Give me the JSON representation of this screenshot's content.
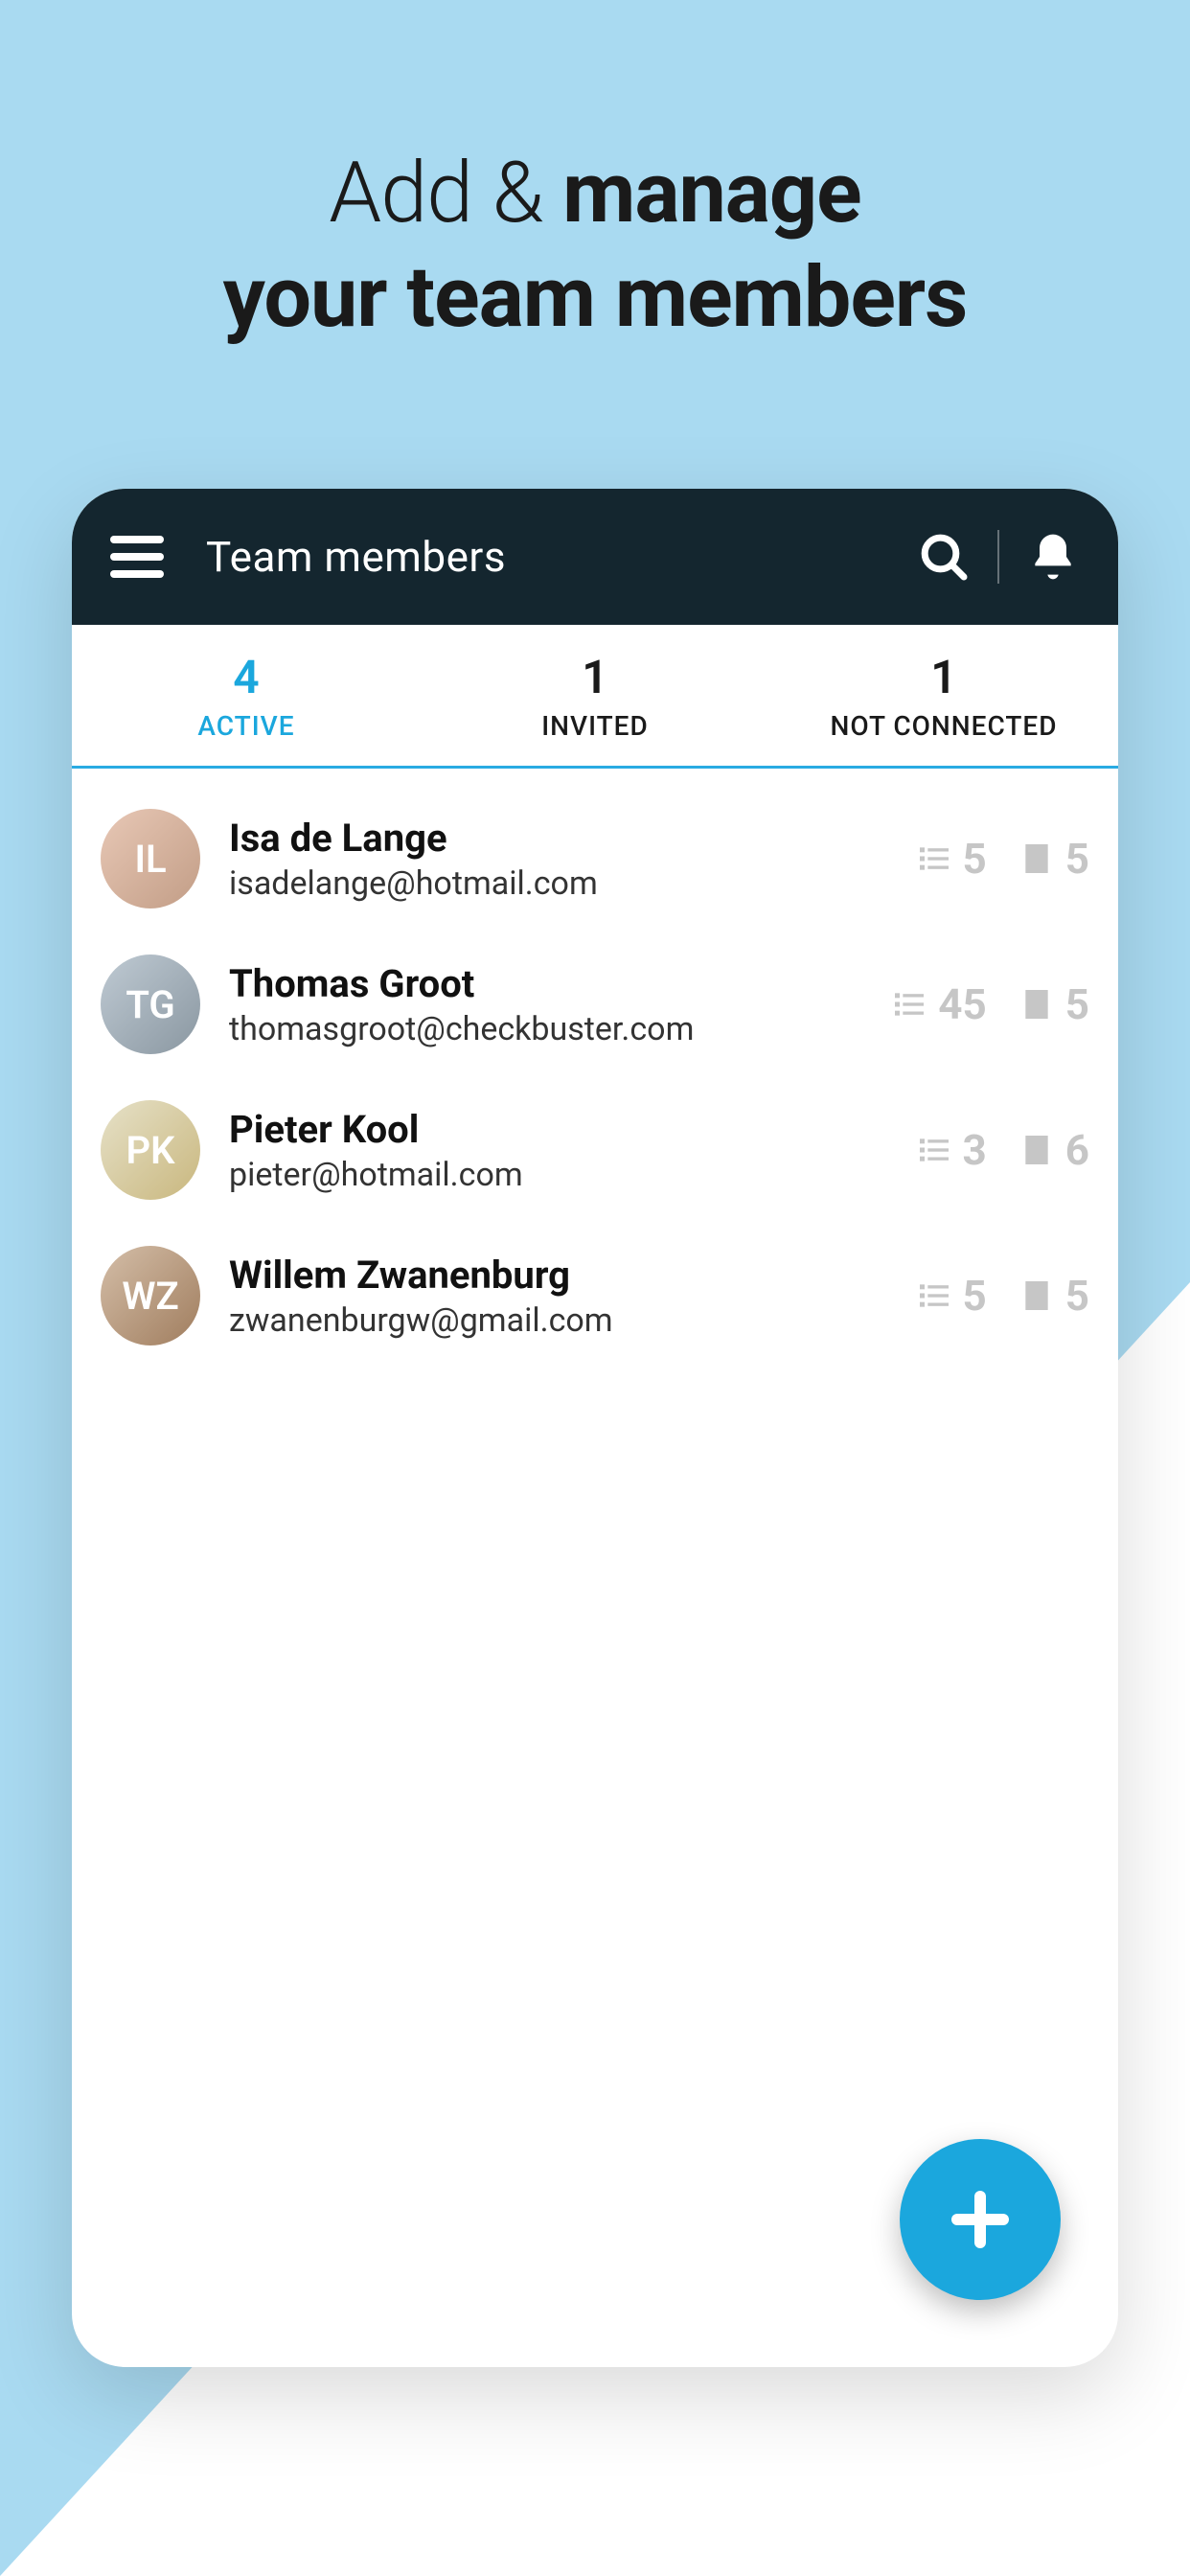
{
  "hero": {
    "line1_light": "Add & ",
    "line1_bold": "manage",
    "line2": "your team members"
  },
  "appbar": {
    "title": "Team members"
  },
  "tabs": [
    {
      "count": "4",
      "label": "ACTIVE",
      "active": true
    },
    {
      "count": "1",
      "label": "INVITED",
      "active": false
    },
    {
      "count": "1",
      "label": "NOT CONNECTED",
      "active": false
    }
  ],
  "members": [
    {
      "name": "Isa de Lange",
      "email": "isadelange@hotmail.com",
      "list_count": "5",
      "building_count": "5",
      "avatar_class": "av1",
      "initials": "IL"
    },
    {
      "name": "Thomas Groot",
      "email": "thomasgroot@checkbuster.com",
      "list_count": "45",
      "building_count": "5",
      "avatar_class": "av2",
      "initials": "TG"
    },
    {
      "name": "Pieter Kool",
      "email": "pieter@hotmail.com",
      "list_count": "3",
      "building_count": "6",
      "avatar_class": "av3",
      "initials": "PK"
    },
    {
      "name": "Willem Zwanenburg",
      "email": "zwanenburgw@gmail.com",
      "list_count": "5",
      "building_count": "5",
      "avatar_class": "av4",
      "initials": "WZ"
    }
  ],
  "colors": {
    "accent": "#1ba7dd",
    "appbar": "#14262f",
    "bg": "#a9daf1"
  }
}
